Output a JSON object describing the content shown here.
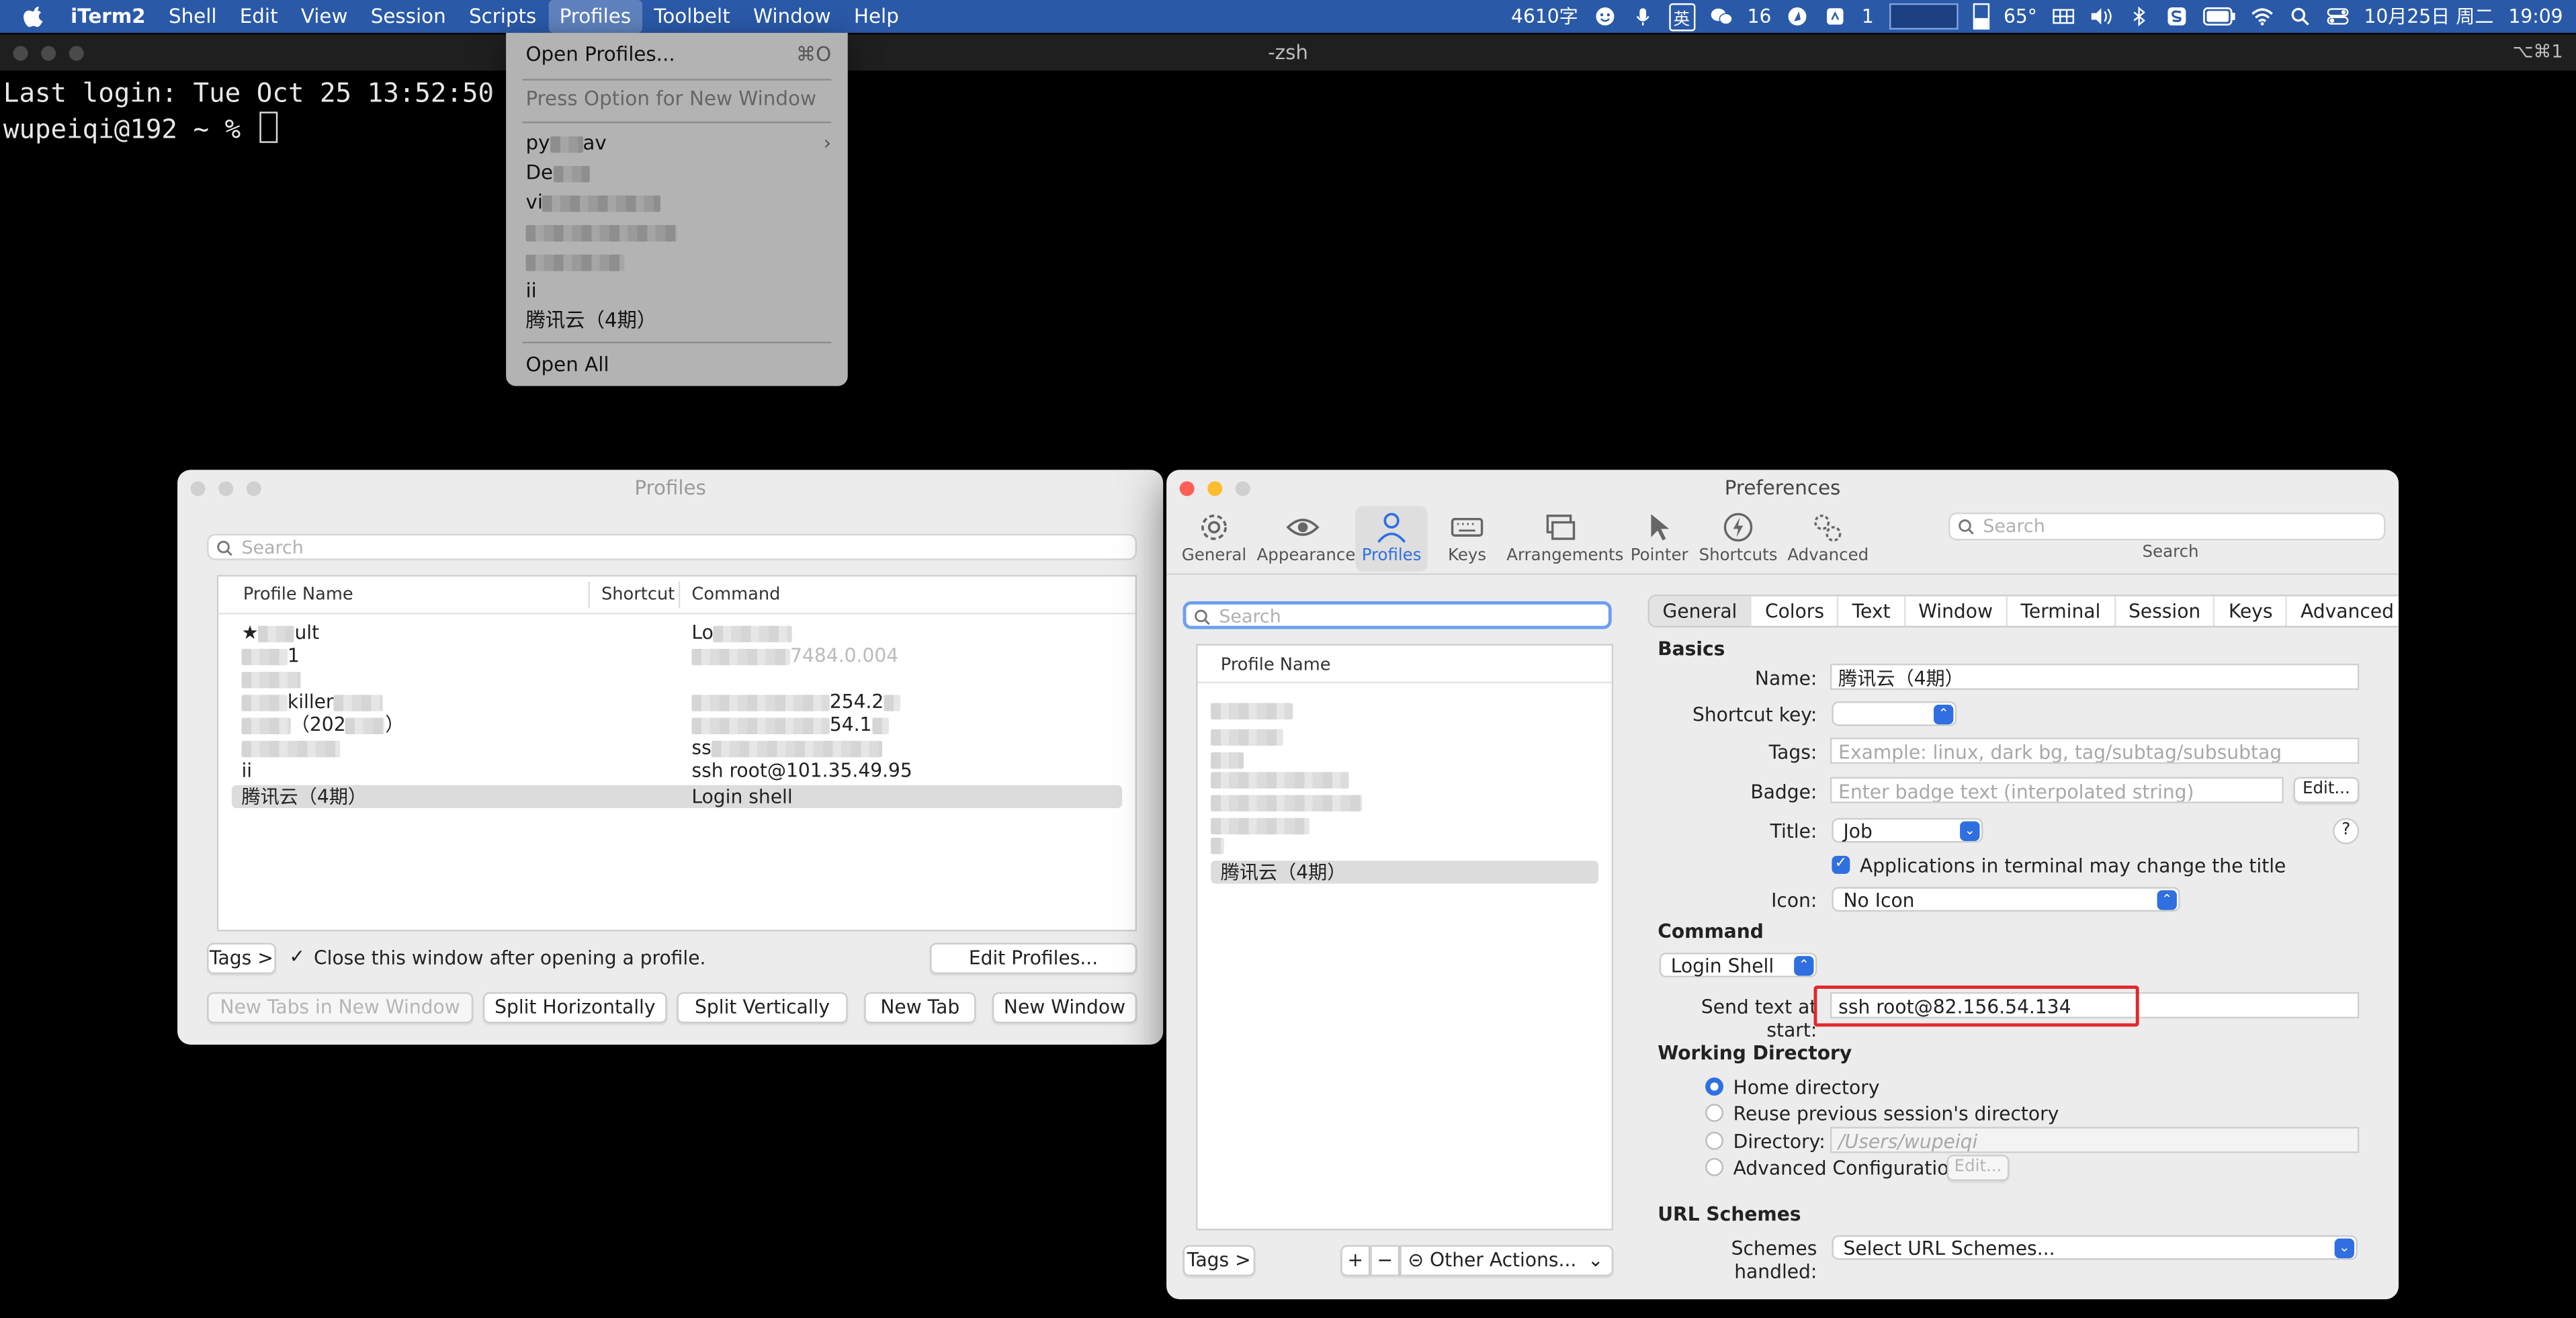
{
  "menubar": {
    "app": "iTerm2",
    "menus": [
      "Shell",
      "Edit",
      "View",
      "Session",
      "Scripts",
      "Profiles",
      "Toolbelt",
      "Window",
      "Help"
    ],
    "status": {
      "word_count": "4610字",
      "ime": "英",
      "wechat_count": "16",
      "count2": "1",
      "temp": "65°",
      "date": "10月25日 周二",
      "time": "19:09"
    }
  },
  "terminal": {
    "title": "-zsh",
    "shortcut": "⌥⌘1",
    "lines": [
      "Last login: Tue Oct 25 13:52:50",
      "wupeiqi@192 ~ % "
    ]
  },
  "profiles_menu": {
    "open_profiles": "Open Profiles...",
    "open_profiles_shortcut": "⌘O",
    "press_option": "Press Option for New Window",
    "item_py": "py",
    "item_py_suffix": "av",
    "item_de": "De",
    "item_vi": "vi",
    "item_ii": "ii",
    "item_tencent": "腾讯云（4期）",
    "open_all": "Open All"
  },
  "profiles_window": {
    "title": "Profiles",
    "search_placeholder": "Search",
    "columns": [
      "Profile Name",
      "Shortcut",
      "Command"
    ],
    "rows": [
      {
        "name": "★",
        "name_tail": "ult",
        "command": "Lo"
      },
      {
        "name": "",
        "name_tail": "1",
        "command": "7484.0.004"
      },
      {
        "name": "",
        "name_tail": "",
        "command": ""
      },
      {
        "name": "",
        "name_tail": "killer",
        "command": "254.2"
      },
      {
        "name": "",
        "name_tail": "（202",
        "name_tail2": "）",
        "command": "54.1"
      },
      {
        "name": "",
        "name_tail": "",
        "command": "ss"
      },
      {
        "name": "ii",
        "name_tail": "",
        "command": "ssh root@101.35.49.95"
      },
      {
        "name": "腾讯云（4期）",
        "name_tail": "",
        "command": "Login shell"
      }
    ],
    "tags_button": "Tags >",
    "close_checkbox_label": "Close this window after opening a profile.",
    "edit_profiles": "Edit Profiles...",
    "buttons": [
      "New Tabs in New Window",
      "Split Horizontally",
      "Split Vertically",
      "New Tab",
      "New Window"
    ]
  },
  "preferences": {
    "title": "Preferences",
    "toolbar": [
      "General",
      "Appearance",
      "Profiles",
      "Keys",
      "Arrangements",
      "Pointer",
      "Shortcuts",
      "Advanced"
    ],
    "search_placeholder": "Search",
    "search_label": "Search",
    "profile_search_placeholder": "Search",
    "profile_list_header": "Profile Name",
    "selected_profile": "腾讯云（4期）",
    "tabs": [
      "General",
      "Colors",
      "Text",
      "Window",
      "Terminal",
      "Session",
      "Keys",
      "Advanced"
    ],
    "basics_header": "Basics",
    "name_label": "Name:",
    "name_value": "腾讯云（4期）",
    "shortcut_label": "Shortcut key:",
    "tags_label": "Tags:",
    "tags_placeholder": "Example: linux, dark bg, tag/subtag/subsubtag",
    "badge_label": "Badge:",
    "badge_placeholder": "Enter badge text (interpolated string)",
    "badge_edit": "Edit...",
    "title_label": "Title:",
    "title_value": "Job",
    "help": "?",
    "apps_change_title": "Applications in terminal may change the title",
    "icon_label": "Icon:",
    "icon_value": "No Icon",
    "command_header": "Command",
    "command_value": "Login Shell",
    "send_text_label": "Send text at start:",
    "send_text_value": "ssh root@82.156.54.134",
    "workdir_header": "Working Directory",
    "wd_home": "Home directory",
    "wd_reuse": "Reuse previous session's directory",
    "wd_directory": "Directory:",
    "wd_directory_placeholder": "/Users/wupeiqi",
    "wd_advanced": "Advanced Configuration",
    "wd_edit": "Edit...",
    "url_header": "URL Schemes",
    "schemes_label": "Schemes handled:",
    "schemes_value": "Select URL Schemes...",
    "tags_button": "Tags >",
    "plus": "+",
    "minus": "−",
    "other_actions": "Other Actions..."
  },
  "colors": {
    "menubar": "#2a59a8",
    "accent": "#2f6fe0",
    "highlight_box": "#e0282e"
  }
}
